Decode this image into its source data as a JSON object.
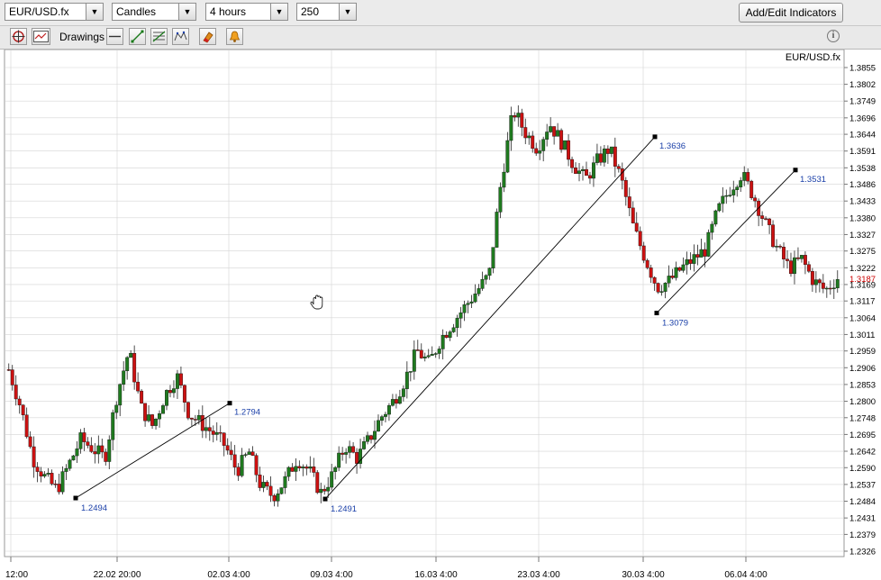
{
  "toolbar": {
    "symbol": "EUR/USD.fx",
    "chart_type": "Candles",
    "timeframe": "4 hours",
    "bars": "250",
    "add_indicators_label": "Add/Edit Indicators",
    "drawings_label": "Drawings"
  },
  "chart": {
    "symbol_label": "EUR/USD.fx",
    "price_axis_labels": [
      "1.3855",
      "1.3802",
      "1.3749",
      "1.3696",
      "1.3644",
      "1.3591",
      "1.3538",
      "1.3486",
      "1.3433",
      "1.3380",
      "1.3327",
      "1.3275",
      "1.3222",
      "1.3169",
      "1.3117",
      "1.3064",
      "1.3011",
      "1.2959",
      "1.2906",
      "1.2853",
      "1.2800",
      "1.2748",
      "1.2695",
      "1.2642",
      "1.2590",
      "1.2537",
      "1.2484",
      "1.2431",
      "1.2379",
      "1.2326"
    ],
    "current_price": "1.3187",
    "time_axis_labels": [
      "12:00",
      "22.02 20:00",
      "02.03 4:00",
      "09.03 4:00",
      "16.03 4:00",
      "23.03 4:00",
      "30.03 4:00",
      "06.04 4:00"
    ],
    "trendlines": [
      {
        "from": "1.2494",
        "to": "1.2794"
      },
      {
        "from": "1.2491",
        "to": "1.3636"
      },
      {
        "from": "1.3079",
        "to": "1.3531"
      }
    ],
    "colors": {
      "up": "#1f7a1f",
      "down": "#cc1111",
      "grid": "#d4d4d4",
      "trend": "#000000",
      "label": "#1a3fa8",
      "current": "#cc0000"
    }
  },
  "chart_data": {
    "type": "candlestick",
    "x_ticks": [
      "12:00",
      "22.02 20:00",
      "02.03 4:00",
      "09.03 4:00",
      "16.03 4:00",
      "23.03 4:00",
      "30.03 4:00",
      "06.04 4:00"
    ],
    "ylim": [
      1.2326,
      1.3855
    ],
    "close_path": [
      1.29,
      1.278,
      1.262,
      1.256,
      1.252,
      1.26,
      1.268,
      1.265,
      1.262,
      1.282,
      1.296,
      1.278,
      1.272,
      1.282,
      1.288,
      1.276,
      1.273,
      1.27,
      1.266,
      1.258,
      1.264,
      1.253,
      1.25,
      1.255,
      1.262,
      1.258,
      1.251,
      1.257,
      1.266,
      1.262,
      1.268,
      1.275,
      1.28,
      1.287,
      1.296,
      1.292,
      1.3,
      1.305,
      1.31,
      1.315,
      1.32,
      1.35,
      1.372,
      1.365,
      1.36,
      1.368,
      1.362,
      1.355,
      1.35,
      1.356,
      1.36,
      1.35,
      1.335,
      1.325,
      1.316,
      1.318,
      1.322,
      1.325,
      1.328,
      1.34,
      1.347,
      1.352,
      1.345,
      1.336,
      1.328,
      1.322,
      1.325,
      1.318,
      1.315,
      1.319
    ]
  }
}
